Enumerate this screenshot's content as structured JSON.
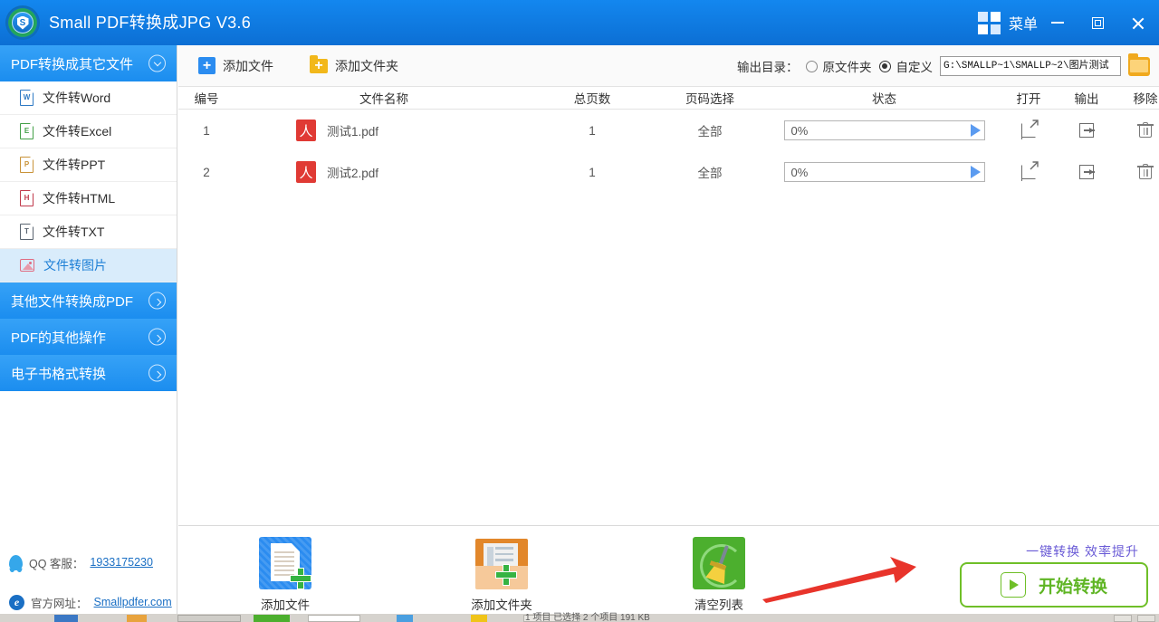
{
  "window": {
    "title": "Small PDF转换成JPG V3.6",
    "logo_letter": "S",
    "menu_label": "菜单",
    "menu_icon": "grid-icon",
    "minimize_icon": "minimize-icon",
    "maximize_icon": "maximize-icon",
    "close_icon": "close-icon",
    "accent_color": "#1387ef"
  },
  "sidebar": {
    "sections": [
      {
        "label": "PDF转换成其它文件",
        "expanded": true
      },
      {
        "label": "其他文件转换成PDF",
        "expanded": false
      },
      {
        "label": "PDF的其他操作",
        "expanded": false
      },
      {
        "label": "电子书格式转换",
        "expanded": false
      }
    ],
    "items": [
      {
        "label": "文件转Word",
        "icon": "word-doc-icon",
        "letter": "W",
        "active": false
      },
      {
        "label": "文件转Excel",
        "icon": "excel-doc-icon",
        "letter": "E",
        "active": false
      },
      {
        "label": "文件转PPT",
        "icon": "ppt-doc-icon",
        "letter": "P",
        "active": false
      },
      {
        "label": "文件转HTML",
        "icon": "html-doc-icon",
        "letter": "H",
        "active": false
      },
      {
        "label": "文件转TXT",
        "icon": "txt-doc-icon",
        "letter": "T",
        "active": false
      },
      {
        "label": "文件转图片",
        "icon": "image-doc-icon",
        "letter": "",
        "active": true
      }
    ],
    "footer": {
      "qq_label": "QQ 客服：",
      "qq_number": "1933175230",
      "site_label": "官方网址：",
      "site_url": "Smallpdfer.com",
      "qq_icon": "qq-penguin-icon",
      "browser_icon": "ie-browser-icon"
    }
  },
  "toolbar": {
    "add_file_label": "添加文件",
    "add_folder_label": "添加文件夹",
    "add_file_icon": "add-file-icon",
    "add_folder_icon": "add-folder-icon",
    "output_dir_label": "输出目录：",
    "radio_original_label": "原文件夹",
    "radio_custom_label": "自定义",
    "radio_selected": "custom",
    "output_path": "G:\\SMALLP~1\\SMALLP~2\\图片测试",
    "browse_icon": "folder-browse-icon"
  },
  "table": {
    "headers": {
      "num": "编号",
      "name": "文件名称",
      "pages": "总页数",
      "page_select": "页码选择",
      "status": "状态",
      "open": "打开",
      "output": "输出",
      "remove": "移除"
    },
    "rows": [
      {
        "num": "1",
        "name": "测试1.pdf",
        "pages": "1",
        "page_select": "全部",
        "status": "0%",
        "file_icon": "pdf-file-icon",
        "start_icon": "play-icon",
        "open_icon": "open-external-icon",
        "output_icon": "export-icon",
        "remove_icon": "trash-icon"
      },
      {
        "num": "2",
        "name": "测试2.pdf",
        "pages": "1",
        "page_select": "全部",
        "status": "0%",
        "file_icon": "pdf-file-icon",
        "start_icon": "play-icon",
        "open_icon": "open-external-icon",
        "output_icon": "export-icon",
        "remove_icon": "trash-icon"
      }
    ]
  },
  "bottom": {
    "actions": [
      {
        "label": "添加文件",
        "icon": "add-file-large-icon"
      },
      {
        "label": "添加文件夹",
        "icon": "add-folder-large-icon"
      },
      {
        "label": "清空列表",
        "icon": "clear-list-broom-icon"
      }
    ],
    "promo_text": "一键转换 效率提升",
    "start_label": "开始转换",
    "start_icon": "play-icon",
    "start_color": "#6fbf28",
    "annotation_arrow": "red-arrow-pointing-to-start-button"
  },
  "background_window": {
    "status_text": "1 项目    已选择 2 个项目   191 KB"
  }
}
